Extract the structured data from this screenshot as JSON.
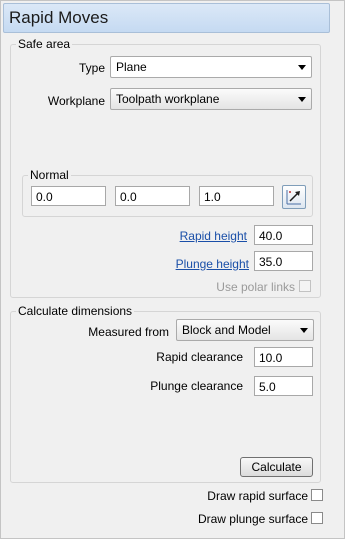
{
  "window": {
    "title": "Rapid Moves"
  },
  "safe_area": {
    "group_label": "Safe area",
    "type": {
      "label": "Type",
      "value": "Plane"
    },
    "workplane": {
      "label": "Workplane",
      "value": "Toolpath workplane"
    },
    "normal": {
      "group_label": "Normal",
      "x": "0.0",
      "y": "0.0",
      "z": "1.0",
      "icon": "pick-direction-icon"
    },
    "rapid_height": {
      "label": "Rapid height",
      "value": "40.0"
    },
    "plunge_height": {
      "label": "Plunge height",
      "value": "35.0"
    },
    "use_polar_links": {
      "label": "Use polar links",
      "checked": false,
      "enabled": false
    }
  },
  "calculate_dimensions": {
    "group_label": "Calculate dimensions",
    "measured_from": {
      "label": "Measured from",
      "value": "Block and Model"
    },
    "rapid_clearance": {
      "label": "Rapid clearance",
      "value": "10.0"
    },
    "plunge_clearance": {
      "label": "Plunge clearance",
      "value": "5.0"
    },
    "calculate_button": "Calculate"
  },
  "draw_rapid_surface": {
    "label": "Draw rapid surface",
    "checked": false
  },
  "draw_plunge_surface": {
    "label": "Draw plunge surface",
    "checked": false
  }
}
